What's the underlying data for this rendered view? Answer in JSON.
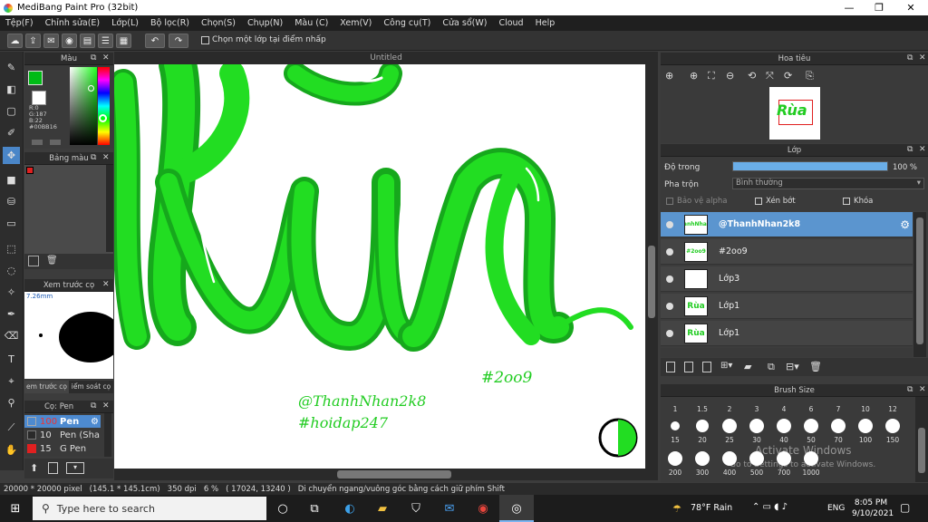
{
  "window": {
    "title": "MediBang Paint Pro (32bit)",
    "minimize": "—",
    "maximize": "❐",
    "close": "✕"
  },
  "menu": [
    "Tệp(F)",
    "Chỉnh sửa(E)",
    "Lớp(L)",
    "Bộ lọc(R)",
    "Chọn(S)",
    "Chụp(N)",
    "Màu (C)",
    "Xem(V)",
    "Công cụ(T)",
    "Cửa sổ(W)",
    "Cloud",
    "Help"
  ],
  "toolbar": {
    "checkbox_label": "Chọn một lớp tại điểm nhấp"
  },
  "color_panel": {
    "title": "Màu",
    "r": "R:0",
    "g": "G:187",
    "b": "B:22",
    "hex": "#00BB16",
    "fg_color": "#00bb16"
  },
  "palette_panel": {
    "title": "Bảng màu"
  },
  "preview_panel": {
    "title": "Xem trước cọ",
    "size": "7.26mm",
    "tab1": "em trước cọ",
    "tab2": "iểm soát cọ"
  },
  "brush_panel": {
    "title": "Cọ: Pen",
    "brushes": [
      {
        "size": "100",
        "name": "Pen",
        "color": "#1a1a1a"
      },
      {
        "size": "10",
        "name": "Pen (Sha",
        "color": "#2a2a2a"
      },
      {
        "size": "15",
        "name": "G Pen",
        "color": "#e02020"
      }
    ]
  },
  "document": {
    "tab": "Untitled"
  },
  "canvas_text": {
    "tag1": "#2oo9",
    "tag2": "@ThanhNhan2k8",
    "tag3": "#hoidap247",
    "main": "Rùa"
  },
  "navigator": {
    "title": "Hoa tiêu"
  },
  "layer_panel": {
    "title": "Lớp",
    "opacity_label": "Độ trong",
    "opacity_value": "100 %",
    "opacity_percent": 100,
    "blend_label": "Pha trộn",
    "blend_value": "Bình thường",
    "protect_alpha": "Bảo vệ alpha",
    "clip": "Xén bớt",
    "lock": "Khóa",
    "layers": [
      {
        "name": "@ThanhNhan2k8",
        "thumb": "@ThanhNhan2k8",
        "selected": true
      },
      {
        "name": "#2oo9",
        "thumb": "#2oo9",
        "selected": false
      },
      {
        "name": "Lớp3",
        "thumb": "",
        "selected": false
      },
      {
        "name": "Lớp1",
        "thumb": "Rùa",
        "selected": false
      },
      {
        "name": "Lớp1",
        "thumb": "Rùa",
        "selected": false
      }
    ]
  },
  "brush_size": {
    "title": "Brush Size",
    "row1_labels": [
      "1",
      "1.5",
      "2",
      "3",
      "4",
      "6",
      "7",
      "10",
      "12"
    ],
    "row2_labels": [
      "15",
      "20",
      "25",
      "30",
      "40",
      "50",
      "70",
      "100",
      "150"
    ],
    "row3_labels": [
      "200",
      "300",
      "400",
      "500",
      "700",
      "1000"
    ]
  },
  "watermark": {
    "line1": "Activate Windows",
    "line2": "Go to Settings to activate Windows."
  },
  "status": {
    "text": "20000 * 20000 pixel   (145.1 * 145.1cm)   350 dpi   6 %   ( 17024, 13240 )   Di chuyển ngang/vuông góc bằng cách giữ phím Shift"
  },
  "taskbar": {
    "search_placeholder": "Type here to search",
    "weather": "78°F  Rain",
    "lang": "ENG",
    "time": "8:05 PM",
    "date": "9/10/2021"
  }
}
